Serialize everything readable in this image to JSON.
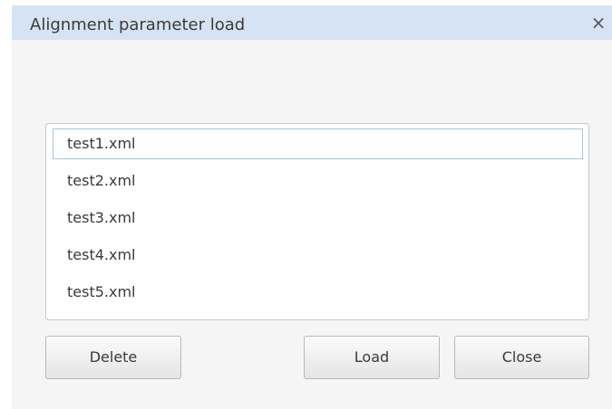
{
  "dialog": {
    "title": "Alignment parameter load",
    "close_glyph": "×"
  },
  "files": [
    {
      "name": "test1.xml",
      "selected": true
    },
    {
      "name": "test2.xml",
      "selected": false
    },
    {
      "name": "test3.xml",
      "selected": false
    },
    {
      "name": "test4.xml",
      "selected": false
    },
    {
      "name": "test5.xml",
      "selected": false
    }
  ],
  "buttons": {
    "delete_label": "Delete",
    "load_label": "Load",
    "close_label": "Close"
  },
  "colors": {
    "titlebar": "#d6e3f4",
    "dialog_background": "#f5f5f5",
    "selection_border": "#a9c2dc"
  }
}
